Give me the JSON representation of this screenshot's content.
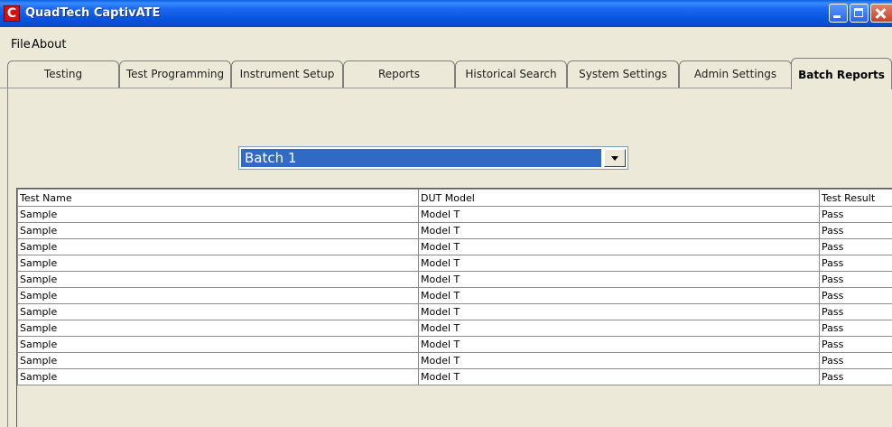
{
  "window": {
    "title": "QuadTech CaptivATE",
    "icon": "app-logo-icon",
    "icon_glyph": "C"
  },
  "menu": [
    "File",
    "About"
  ],
  "tabs": [
    {
      "label": "Testing",
      "active": false
    },
    {
      "label": "Test Programming",
      "active": false
    },
    {
      "label": "Instrument Setup",
      "active": false
    },
    {
      "label": "Reports",
      "active": false
    },
    {
      "label": "Historical Search",
      "active": false
    },
    {
      "label": "System Settings",
      "active": false
    },
    {
      "label": "Admin Settings",
      "active": false
    },
    {
      "label": "Batch Reports",
      "active": true
    }
  ],
  "batch_select": {
    "value": "Batch 1"
  },
  "grid": {
    "columns": [
      "Test Name",
      "DUT Model",
      "Test Result"
    ],
    "rows": [
      [
        "Sample",
        "Model T",
        "Pass"
      ],
      [
        "Sample",
        "Model T",
        "Pass"
      ],
      [
        "Sample",
        "Model T",
        "Pass"
      ],
      [
        "Sample",
        "Model T",
        "Pass"
      ],
      [
        "Sample",
        "Model T",
        "Pass"
      ],
      [
        "Sample",
        "Model T",
        "Pass"
      ],
      [
        "Sample",
        "Model T",
        "Pass"
      ],
      [
        "Sample",
        "Model T",
        "Pass"
      ],
      [
        "Sample",
        "Model T",
        "Pass"
      ],
      [
        "Sample",
        "Model T",
        "Pass"
      ],
      [
        "Sample",
        "Model T",
        "Pass"
      ]
    ]
  },
  "colors": {
    "titlebar": "#0855dd",
    "selection": "#316ac5",
    "window_bg": "#ece9d8"
  }
}
